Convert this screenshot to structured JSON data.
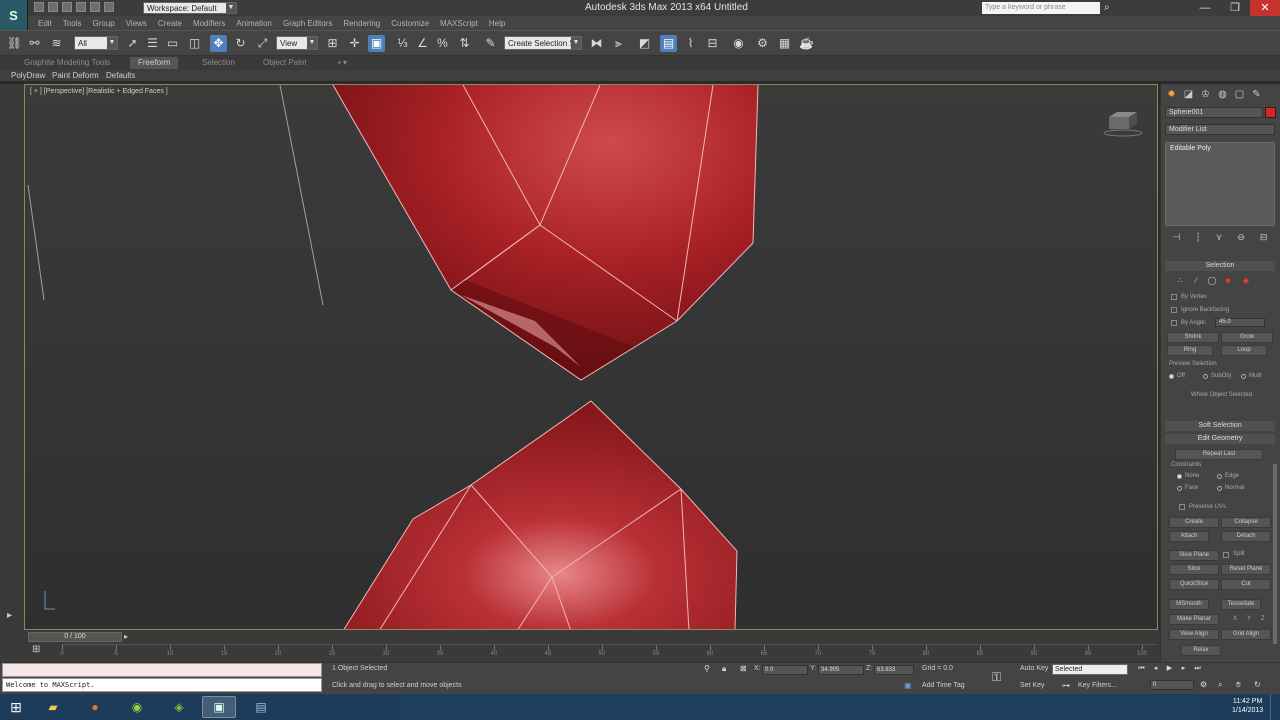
{
  "titlebar": {
    "logo": "S",
    "workspace": "Workspace: Default",
    "window_title": "Autodesk 3ds Max  2013 x64       Untitled",
    "search_placeholder": "Type a keyword or phrase"
  },
  "menu": [
    "Edit",
    "Tools",
    "Group",
    "Views",
    "Create",
    "Modifiers",
    "Animation",
    "Graph Editors",
    "Rendering",
    "Customize",
    "MAXScript",
    "Help"
  ],
  "toolbar": {
    "selection_filter": "All",
    "ref_coord": "View",
    "named_selection": "Create Selection Se"
  },
  "ribbon": {
    "tabs": [
      "Graphite Modeling Tools",
      "Freeform",
      "Selection",
      "Object Paint"
    ],
    "active_tab": "Freeform",
    "sub_items": [
      "PolyDraw",
      "Paint Deform",
      "Defaults"
    ]
  },
  "viewport": {
    "label": "[ + ] [Perspective] [Realistic + Edged Faces ]",
    "colors": {
      "mesh": "#b3262a",
      "edge": "#f0b3b3",
      "frame": "#8a8a5a"
    }
  },
  "command_panel": {
    "object_name": "Sphere001",
    "modifier_list": "Modifier List",
    "stack_item": "Editable Poly",
    "selection_title": "Selection",
    "options": [
      "By Vertex",
      "Ignore Backfacing",
      "By Angle:"
    ],
    "angle_value": "45.0",
    "buttons_row1": [
      "Shrink",
      "Grow"
    ],
    "buttons_row2": [
      "Ring",
      "Loop"
    ],
    "preview_label": "Preview Selection",
    "preview_options": [
      "Off",
      "SubObj",
      "Multi"
    ],
    "whole_object": "Whole Object Selected",
    "soft_selection": "Soft Selection",
    "edit_geometry": "Edit Geometry",
    "repeat_last": "Repeat Last",
    "constraints_label": "Constraints",
    "constraints": [
      "None",
      "Edge",
      "Face",
      "Normal"
    ],
    "preserve_uvs": "Preserve UVs",
    "create": "Create",
    "collapse": "Collapse",
    "attach": "Attach",
    "detach": "Detach",
    "slice_plane": "Slice Plane",
    "split": "Split",
    "slice": "Slice",
    "reset_plane": "Reset Plane",
    "quickslice": "QuickSlice",
    "cut": "Cut",
    "msmooth": "MSmooth",
    "tessellate": "Tessellate",
    "make_planar": "Make Planar",
    "xyz": [
      "X",
      "Y",
      "Z"
    ],
    "view_align": "View Align",
    "grid_align": "Grid Align",
    "relax": "Relax"
  },
  "timeline": {
    "slider_label": "0 / 100",
    "ticks": [
      0,
      5,
      10,
      15,
      20,
      25,
      30,
      35,
      40,
      45,
      50,
      55,
      60,
      65,
      70,
      75,
      80,
      85,
      90,
      95,
      100
    ]
  },
  "status": {
    "maxscript_output": "Welcome to MAXScript.",
    "objects_selected": "1 Object Selected",
    "prompt": "Click and drag to select and move objects",
    "x_label": "X:",
    "x_value": "0.0",
    "y_label": "Y:",
    "y_value": "34.905",
    "z_label": "Z:",
    "z_value": "63.833",
    "grid": "Grid = 0.0",
    "add_time_tag": "Add Time Tag",
    "auto_key": "Auto Key",
    "set_key": "Set Key",
    "key_mode": "Selected",
    "key_filters": "Key Filters...",
    "frame": "0"
  },
  "taskbar": {
    "apps": [
      "folder-app",
      "firefox-app",
      "android-app",
      "nvidia-app",
      "3dsmax-app",
      "notepad-app"
    ],
    "clock_time": "11:42 PM",
    "clock_date": "1/14/2013"
  }
}
